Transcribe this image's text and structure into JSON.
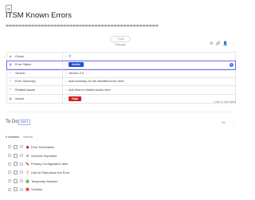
{
  "page": {
    "title": "ITSM Known Errors",
    "rule_text": "================================================",
    "add_subpage": "+ Add Subpage"
  },
  "toolbar": {
    "right": [
      "⚙",
      "🔗",
      "👤",
      "⋯"
    ]
  },
  "fields": [
    {
      "icon": "person-icon",
      "name": "Owner",
      "value": "",
      "kind": "owner"
    },
    {
      "icon": "status-icon",
      "name": "Error Status",
      "value": "Active",
      "kind": "badge",
      "color": "#1e4fe0"
    },
    {
      "icon": "text-icon",
      "name": "Version",
      "value": "Version 2.0",
      "kind": "text"
    },
    {
      "icon": "text-icon",
      "name": "Error Summary",
      "value": "Add summary for the identified error here.",
      "kind": "text"
    },
    {
      "icon": "text-icon",
      "name": "Related Issues",
      "value": "Add links to related issues here.",
      "kind": "text"
    },
    {
      "icon": "status-icon",
      "name": "Impact",
      "value": "High",
      "kind": "badge",
      "color": "#d11f1f"
    }
  ],
  "hide_fields_label": "+ Add or edit fields",
  "todo": {
    "title": "To Do",
    "add_label": "Add ▾",
    "tools": [
      "All",
      "⋯"
    ]
  },
  "subtasks": {
    "count_label": "6 subtasks",
    "sort_label": "Manual",
    "items": [
      {
        "emoji": "🐞",
        "label": "Error Description"
      },
      {
        "emoji": "⚙",
        "label": "Services Impacted"
      },
      {
        "emoji": "🔖",
        "label": "Primary Configuration Item"
      },
      {
        "emoji": "❓",
        "label": "How to Reproduce the Error"
      },
      {
        "emoji": "🟢",
        "label": "Temporary Solution"
      },
      {
        "emoji": "🔴",
        "label": "Solution"
      }
    ]
  }
}
